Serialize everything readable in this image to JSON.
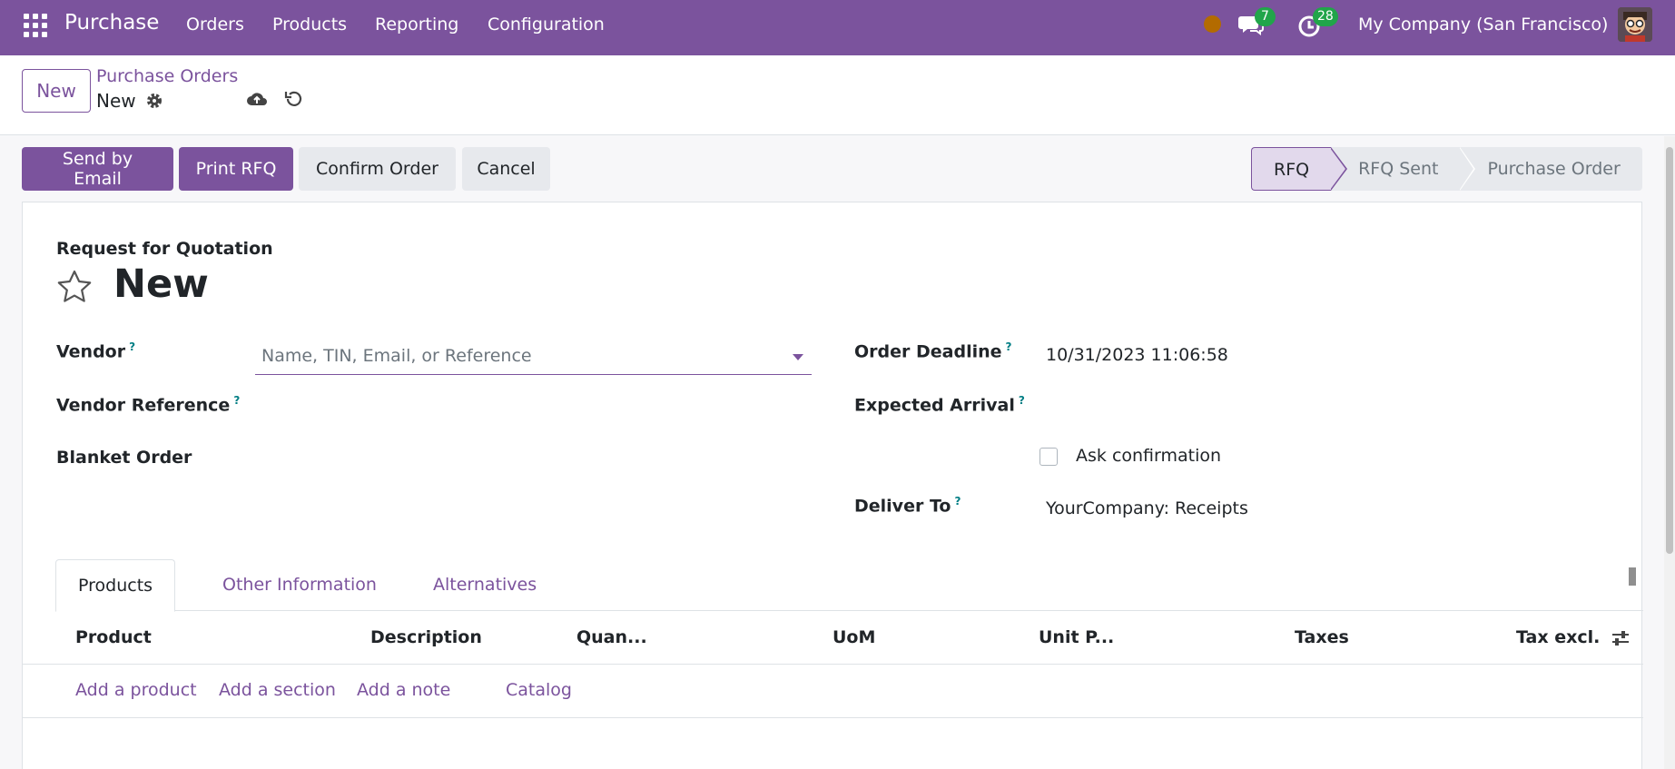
{
  "navbar": {
    "brand": "Purchase",
    "menus": [
      "Orders",
      "Products",
      "Reporting",
      "Configuration"
    ],
    "chat_count": "7",
    "activity_count": "28",
    "company": "My Company (San Francisco)"
  },
  "control": {
    "new_label": "New",
    "breadcrumb_parent": "Purchase Orders",
    "breadcrumb_current": "New"
  },
  "actions": {
    "send_email": "Send by Email",
    "print_rfq": "Print RFQ",
    "confirm": "Confirm Order",
    "cancel": "Cancel"
  },
  "statusbar": [
    "RFQ",
    "RFQ Sent",
    "Purchase Order"
  ],
  "form": {
    "title_label": "Request for Quotation",
    "title_value": "New",
    "vendor_label": "Vendor",
    "vendor_placeholder": "Name, TIN, Email, or Reference",
    "vendor_ref_label": "Vendor Reference",
    "blanket_label": "Blanket Order",
    "deadline_label": "Order Deadline",
    "deadline_value": "10/31/2023 11:06:58",
    "arrival_label": "Expected Arrival",
    "ask_confirmation": "Ask confirmation",
    "deliver_label": "Deliver To",
    "deliver_value": "YourCompany: Receipts",
    "help_mark": "?"
  },
  "tabs": [
    "Products",
    "Other Information",
    "Alternatives"
  ],
  "table": {
    "columns": [
      "Product",
      "Description",
      "Quan...",
      "UoM",
      "Unit P...",
      "Taxes",
      "Tax excl."
    ],
    "row_actions": [
      "Add a product",
      "Add a section",
      "Add a note",
      "Catalog"
    ]
  },
  "colors": {
    "brand": "#7b539d",
    "badge": "#21a54a",
    "help": "#017e84"
  },
  "icons": [
    "apps-grid-icon",
    "chat-icon",
    "clock-icon",
    "gear-icon",
    "cloud-upload-icon",
    "undo-icon",
    "star-icon",
    "column-settings-icon"
  ]
}
